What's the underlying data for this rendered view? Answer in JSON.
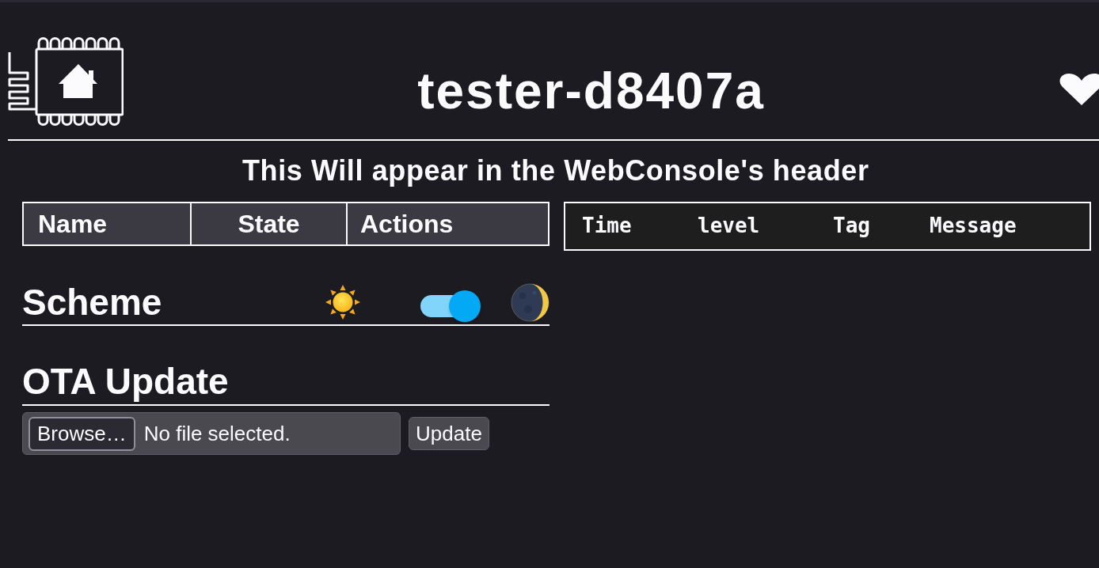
{
  "header": {
    "title": "tester-d8407a"
  },
  "subtitle": "This Will appear in the WebConsole's header",
  "entities_table": {
    "columns": [
      "Name",
      "State",
      "Actions"
    ]
  },
  "log_table": {
    "columns": [
      "Time",
      "level",
      "Tag",
      "Message"
    ]
  },
  "scheme": {
    "label": "Scheme",
    "dark_mode": {
      "on": true
    }
  },
  "ota": {
    "label": "OTA Update",
    "file_input": {
      "button": "Browse…",
      "status": "No file selected."
    },
    "update_button": "Update"
  }
}
